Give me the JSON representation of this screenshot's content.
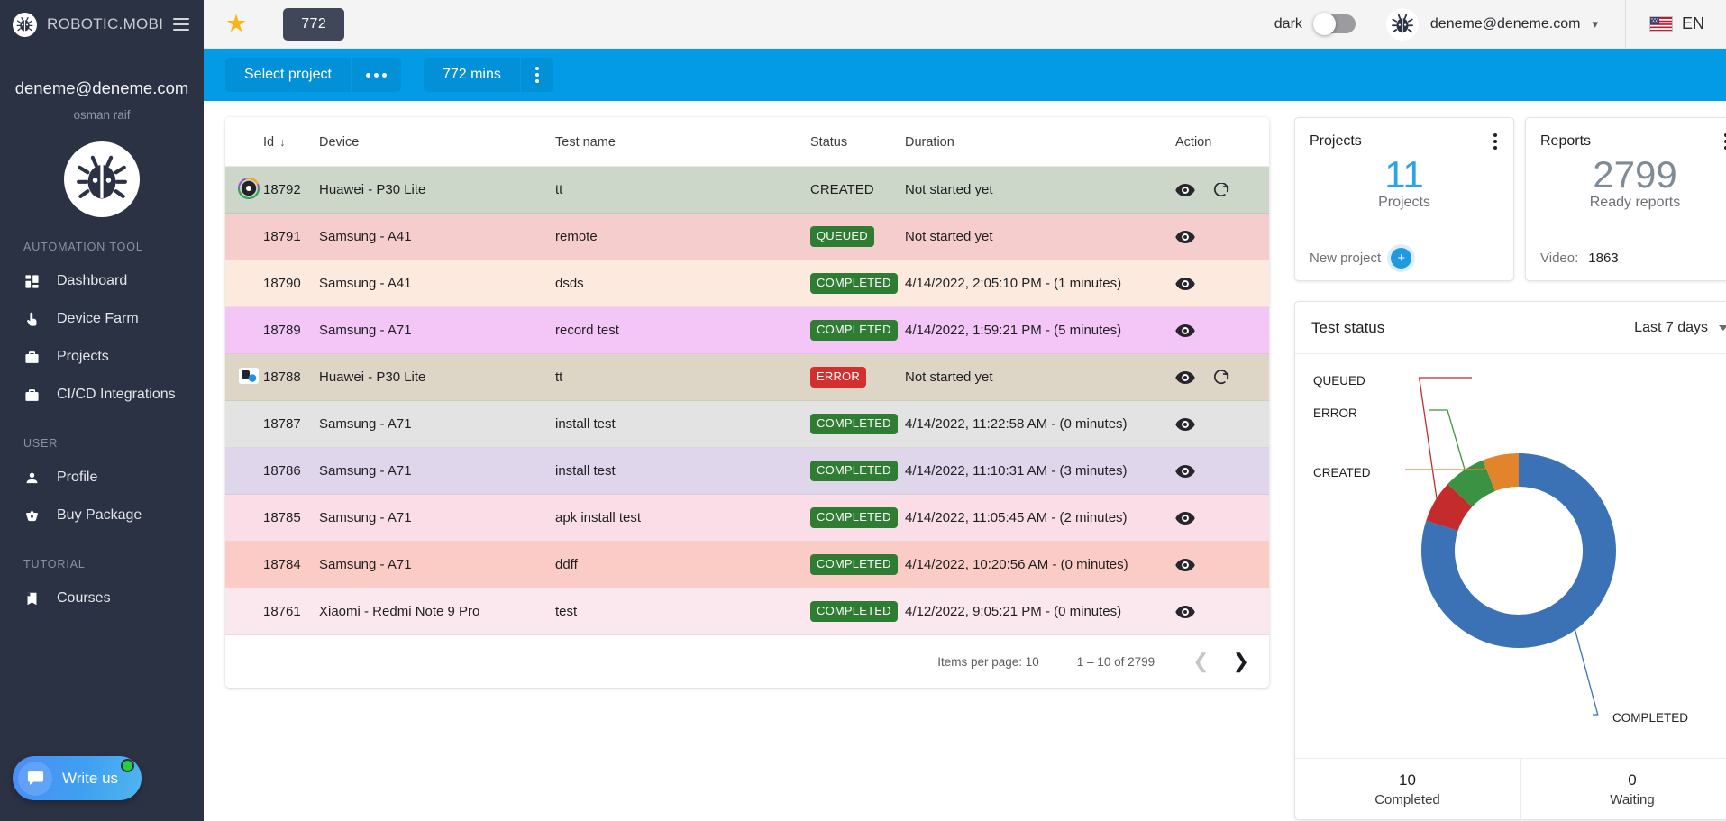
{
  "sidebar": {
    "brand": "ROBOTIC.MOBI",
    "brand_logo_icon": "bug-logo-icon",
    "menu_icon": "hamburger-icon",
    "user_email": "deneme@deneme.com",
    "user_name": "osman raif",
    "avatar_icon": "bug-avatar-icon",
    "sections": [
      {
        "title": "AUTOMATION TOOL",
        "items": [
          {
            "label": "Dashboard",
            "icon": "dashboard-icon"
          },
          {
            "label": "Device Farm",
            "icon": "touch-icon"
          },
          {
            "label": "Projects",
            "icon": "briefcase-icon"
          },
          {
            "label": "CI/CD Integrations",
            "icon": "briefcase-icon"
          }
        ]
      },
      {
        "title": "USER",
        "items": [
          {
            "label": "Profile",
            "icon": "person-icon"
          },
          {
            "label": "Buy Package",
            "icon": "basket-icon"
          }
        ]
      },
      {
        "title": "TUTORIAL",
        "items": [
          {
            "label": "Courses",
            "icon": "book-icon"
          }
        ]
      }
    ],
    "write_us": {
      "label": "Write us",
      "icon": "chat-bubble-icon",
      "online": true
    }
  },
  "topbar": {
    "star_icon": "star-icon",
    "minutes_chip": "772",
    "dark_label": "dark",
    "dark_enabled": false,
    "account_avatar_icon": "bug-avatar-icon",
    "account_email": "deneme@deneme.com",
    "account_caret_icon": "chevron-down-icon",
    "flag_icon": "us-flag-icon",
    "language": "EN"
  },
  "toolbar": {
    "select_project_label": "Select project",
    "select_project_more_icon": "ellipsis-horizontal-icon",
    "minutes_label": "772 mins",
    "minutes_more_icon": "kebab-vertical-icon",
    "accent_color": "#039be5"
  },
  "table": {
    "columns": [
      "Id",
      "Device",
      "Test name",
      "Status",
      "Duration",
      "Action"
    ],
    "sort_column": "Id",
    "sort_icon": "arrow-down-icon",
    "rows": [
      {
        "id": "18792",
        "device": "Huawei - P30 Lite",
        "test": "tt",
        "status": "CREATED",
        "status_style": "plain",
        "duration": "Not started yet",
        "actions": [
          "eye-icon",
          "redo-icon"
        ],
        "row_color": "#ccd6c9",
        "lead_icon": "record-ring-icon"
      },
      {
        "id": "18791",
        "device": "Samsung - A41",
        "test": "remote",
        "status": "QUEUED",
        "status_style": "green",
        "duration": "Not started yet",
        "actions": [
          "eye-icon"
        ],
        "row_color": "#f6cdcd",
        "lead_icon": ""
      },
      {
        "id": "18790",
        "device": "Samsung - A41",
        "test": "dsds",
        "status": "COMPLETED",
        "status_style": "green",
        "duration": "4/14/2022, 2:05:10 PM - (1 minutes)",
        "actions": [
          "eye-icon"
        ],
        "row_color": "#fdeade",
        "lead_icon": ""
      },
      {
        "id": "18789",
        "device": "Samsung - A71",
        "test": "record test",
        "status": "COMPLETED",
        "status_style": "green",
        "duration": "4/14/2022, 1:59:21 PM - (5 minutes)",
        "actions": [
          "eye-icon"
        ],
        "row_color": "#f4c6f8",
        "lead_icon": ""
      },
      {
        "id": "18788",
        "device": "Huawei - P30 Lite",
        "test": "tt",
        "status": "ERROR",
        "status_style": "red",
        "duration": "Not started yet",
        "actions": [
          "eye-icon",
          "redo-icon"
        ],
        "row_color": "#ddd6c7",
        "lead_icon": "screens-icon"
      },
      {
        "id": "18787",
        "device": "Samsung - A71",
        "test": "install test",
        "status": "COMPLETED",
        "status_style": "green",
        "duration": "4/14/2022, 11:22:58 AM - (0 minutes)",
        "actions": [
          "eye-icon"
        ],
        "row_color": "#e3e3e3",
        "lead_icon": ""
      },
      {
        "id": "18786",
        "device": "Samsung - A71",
        "test": "install test",
        "status": "COMPLETED",
        "status_style": "green",
        "duration": "4/14/2022, 11:10:31 AM - (3 minutes)",
        "actions": [
          "eye-icon"
        ],
        "row_color": "#e0d6ec",
        "lead_icon": ""
      },
      {
        "id": "18785",
        "device": "Samsung - A71",
        "test": "apk install test",
        "status": "COMPLETED",
        "status_style": "green",
        "duration": "4/14/2022, 11:05:45 AM - (2 minutes)",
        "actions": [
          "eye-icon"
        ],
        "row_color": "#fbdde8",
        "lead_icon": ""
      },
      {
        "id": "18784",
        "device": "Samsung - A71",
        "test": "ddff",
        "status": "COMPLETED",
        "status_style": "green",
        "duration": "4/14/2022, 10:20:56 AM - (0 minutes)",
        "actions": [
          "eye-icon"
        ],
        "row_color": "#fbcbc5",
        "lead_icon": ""
      },
      {
        "id": "18761",
        "device": "Xiaomi - Redmi Note 9 Pro",
        "test": "test",
        "status": "COMPLETED",
        "status_style": "green",
        "duration": "4/12/2022, 9:05:21 PM - (0 minutes)",
        "actions": [
          "eye-icon"
        ],
        "row_color": "#fbe7ee",
        "lead_icon": ""
      }
    ],
    "paginator": {
      "items_per_page_label": "Items per page: 10",
      "range_label": "1 – 10 of 2799",
      "prev_icon": "chevron-left-icon",
      "next_icon": "chevron-right-icon",
      "prev_enabled": false,
      "next_enabled": true
    }
  },
  "projects_card": {
    "title": "Projects",
    "menu_icon": "kebab-vertical-icon",
    "value": "11",
    "caption": "Projects",
    "footer_label": "New project",
    "footer_icon": "plus-circle-icon"
  },
  "reports_card": {
    "title": "Reports",
    "menu_icon": "kebab-vertical-icon",
    "value": "2799",
    "caption": "Ready reports",
    "footer_label": "Video:",
    "footer_value": "1863"
  },
  "test_status_card": {
    "title": "Test status",
    "range": "Last 7 days",
    "range_caret_icon": "caret-down-icon",
    "completed_num": "10",
    "completed_label": "Completed",
    "waiting_num": "0",
    "waiting_label": "Waiting"
  },
  "chart_data": {
    "type": "pie",
    "title": "Test status",
    "subtitle": "Last 7 days",
    "donut": true,
    "labels": [
      "COMPLETED",
      "QUEUED",
      "ERROR",
      "CREATED"
    ],
    "values": [
      80,
      7,
      7,
      6
    ],
    "colors": [
      "#3b72b5",
      "#c32b2d",
      "#3c9243",
      "#e2842c"
    ],
    "legend": "callout-labels",
    "annotations": [
      {
        "label": "QUEUED",
        "color": "#c32b2d"
      },
      {
        "label": "ERROR",
        "color": "#3c9243"
      },
      {
        "label": "CREATED",
        "color": "#e2842c"
      },
      {
        "label": "COMPLETED",
        "color": "#3b72b5"
      }
    ]
  }
}
